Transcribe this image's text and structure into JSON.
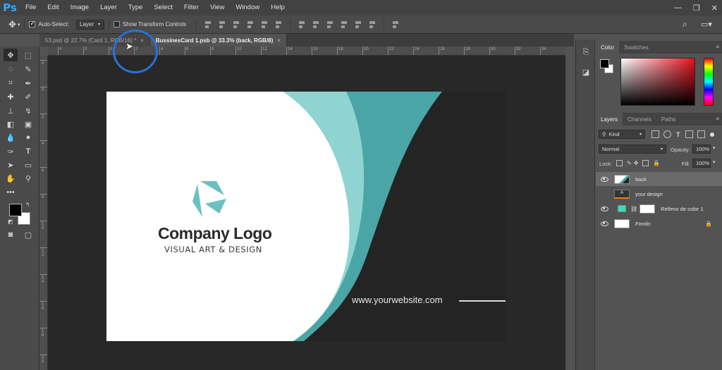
{
  "app": {
    "logo": "Ps"
  },
  "menu": [
    "File",
    "Edit",
    "Image",
    "Layer",
    "Type",
    "Select",
    "Filter",
    "View",
    "Window",
    "Help"
  ],
  "window_controls": {
    "minimize": "—",
    "restore": "❐",
    "close": "✕"
  },
  "options": {
    "auto_select_label": "Auto-Select:",
    "auto_select_checked": true,
    "auto_select_value": "Layer",
    "show_transform_label": "Show Transform Controls"
  },
  "tabs": [
    {
      "label": "53.psd @ 22.7% (Card 1, RGB/16) *",
      "close": "×",
      "active": false
    },
    {
      "label": "BussinesCard 1.psb @ 33.3% (back, RGB/8)",
      "close": "×",
      "active": true
    }
  ],
  "ruler_top": [
    "4",
    "2",
    "0",
    "2",
    "4",
    "6",
    "8",
    "10",
    "12",
    "14",
    "16",
    "18",
    "20",
    "22",
    "24",
    "26",
    "28",
    "30",
    "32",
    "34",
    "36",
    "38"
  ],
  "ruler_left": [
    "2",
    "0",
    "2",
    "4",
    "6",
    "8",
    "1\n0",
    "1\n2",
    "1\n4",
    "1\n6",
    "1\n8",
    "2\n0"
  ],
  "card": {
    "company": "Company Logo",
    "tagline": "VISUAL ART & DESIGN",
    "website": "www.yourwebsite.com",
    "colors": {
      "teal_light": "#8fd4d1",
      "teal": "#5fb6b4",
      "teal_dark": "#4aa5a6",
      "white": "#ffffff",
      "dark": "#242424"
    }
  },
  "color_panel": {
    "tabs": [
      "Color",
      "Swatches"
    ],
    "foreground": "#000000",
    "background": "#ffffff"
  },
  "layers_panel": {
    "tabs": [
      "Layers",
      "Channels",
      "Paths"
    ],
    "filter_kind": "Kind",
    "blend_mode": "Normal",
    "opacity_label": "Opacity:",
    "opacity_value": "100%",
    "lock_label": "Lock:",
    "fill_label": "Fill:",
    "fill_value": "100%",
    "layers": [
      {
        "name": "back",
        "selected": true
      },
      {
        "name": "your design",
        "selected": false
      },
      {
        "name": "Relleno de color 1",
        "selected": false
      },
      {
        "name": "Fondo",
        "selected": false
      }
    ]
  }
}
